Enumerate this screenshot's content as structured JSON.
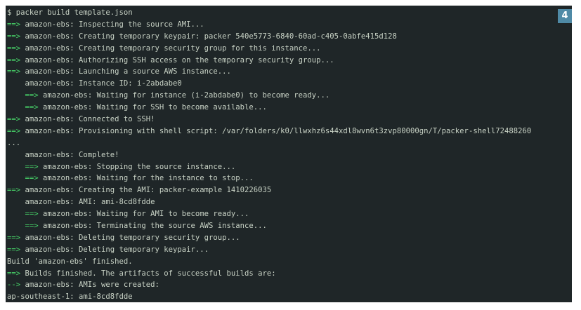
{
  "terminal": {
    "badge": "4",
    "lines": [
      {
        "indent": "",
        "prefix": "",
        "text": "$ packer build template.json"
      },
      {
        "indent": "",
        "prefix": "==>",
        "text": " amazon-ebs: Inspecting the source AMI..."
      },
      {
        "indent": "",
        "prefix": "==>",
        "text": " amazon-ebs: Creating temporary keypair: packer 540e5773-6840-60ad-c405-0abfe415d128"
      },
      {
        "indent": "",
        "prefix": "==>",
        "text": " amazon-ebs: Creating temporary security group for this instance..."
      },
      {
        "indent": "",
        "prefix": "==>",
        "text": " amazon-ebs: Authorizing SSH access on the temporary security group..."
      },
      {
        "indent": "",
        "prefix": "==>",
        "text": " amazon-ebs: Launching a source AWS instance..."
      },
      {
        "indent": "    ",
        "prefix": "",
        "text": "amazon-ebs: Instance ID: i-2abdabe0"
      },
      {
        "indent": "    ",
        "prefix": "==>",
        "text": " amazon-ebs: Waiting for instance (i-2abdabe0) to become ready..."
      },
      {
        "indent": "    ",
        "prefix": "==>",
        "text": " amazon-ebs: Waiting for SSH to become available..."
      },
      {
        "indent": "",
        "prefix": "==>",
        "text": " amazon-ebs: Connected to SSH!"
      },
      {
        "indent": "",
        "prefix": "==>",
        "text": " amazon-ebs: Provisioning with shell script: /var/folders/k0/llwxhz6s44xdl8wvn6t3zvp80000gn/T/packer-shell72488260"
      },
      {
        "indent": "",
        "prefix": "",
        "text": "..."
      },
      {
        "indent": "    ",
        "prefix": "",
        "text": "amazon-ebs: Complete!"
      },
      {
        "indent": "    ",
        "prefix": "==>",
        "text": " amazon-ebs: Stopping the source instance..."
      },
      {
        "indent": "    ",
        "prefix": "==>",
        "text": " amazon-ebs: Waiting for the instance to stop..."
      },
      {
        "indent": "",
        "prefix": "==>",
        "text": " amazon-ebs: Creating the AMI: packer-example 1410226035"
      },
      {
        "indent": "    ",
        "prefix": "",
        "text": "amazon-ebs: AMI: ami-8cd8fdde"
      },
      {
        "indent": "    ",
        "prefix": "==>",
        "text": " amazon-ebs: Waiting for AMI to become ready..."
      },
      {
        "indent": "    ",
        "prefix": "==>",
        "text": " amazon-ebs: Terminating the source AWS instance..."
      },
      {
        "indent": "",
        "prefix": "==>",
        "text": " amazon-ebs: Deleting temporary security group..."
      },
      {
        "indent": "",
        "prefix": "==>",
        "text": " amazon-ebs: Deleting temporary keypair..."
      },
      {
        "indent": "",
        "prefix": "",
        "text": "Build 'amazon-ebs' finished."
      },
      {
        "indent": "",
        "prefix": "==>",
        "text": " Builds finished. The artifacts of successful builds are:"
      },
      {
        "indent": "",
        "prefix": "-->",
        "text": " amazon-ebs: AMIs were created:"
      },
      {
        "indent": "",
        "prefix": "",
        "text": "ap-southeast-1: ami-8cd8fdde"
      }
    ]
  }
}
